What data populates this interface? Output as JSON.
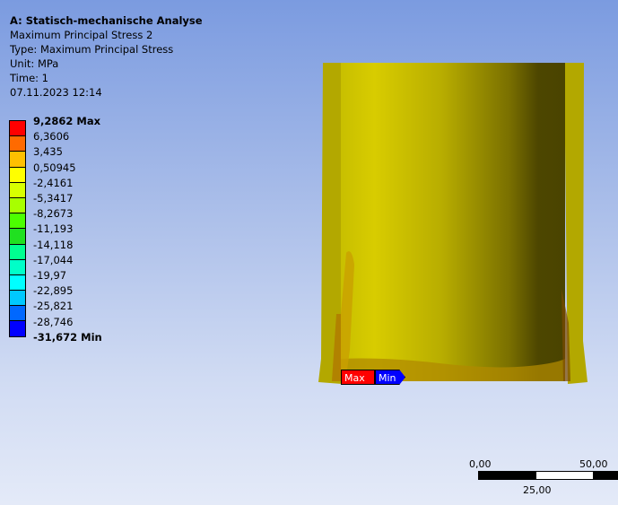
{
  "header": {
    "title": "A: Statisch-mechanische Analyse",
    "result_name": "Maximum Principal Stress 2",
    "type": "Type: Maximum Principal Stress",
    "unit": "Unit: MPa",
    "time": "Time: 1",
    "date": "07.11.2023 12:14"
  },
  "legend": {
    "labels": [
      "9,2862 Max",
      "6,3606",
      "3,435",
      "0,50945",
      "-2,4161",
      "-5,3417",
      "-8,2673",
      "-11,193",
      "-14,118",
      "-17,044",
      "-19,97",
      "-22,895",
      "-25,821",
      "-28,746",
      "-31,672 Min"
    ],
    "colors": [
      "#ff0000",
      "#ff6a00",
      "#ffc000",
      "#ffff00",
      "#d8ff00",
      "#a8ff00",
      "#4cff00",
      "#20e020",
      "#00ff90",
      "#00ffc8",
      "#00ffff",
      "#00c8ff",
      "#0068ff",
      "#0000ff"
    ]
  },
  "markers": {
    "max": "Max",
    "min": "Min"
  },
  "scale_bar": {
    "left": "0,00",
    "right": "50,00",
    "middle": "25,00"
  }
}
